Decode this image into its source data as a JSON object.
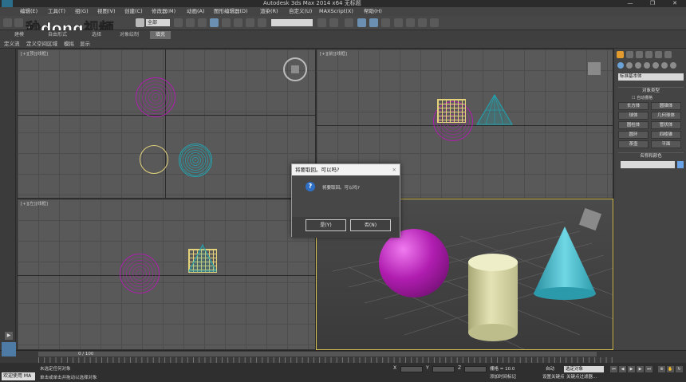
{
  "window": {
    "title": "Autodesk 3ds Max  2014 x64      无标题",
    "minimize": "—",
    "maximize": "❐",
    "close": "✕"
  },
  "menu": [
    "编辑(E)",
    "工具(T)",
    "组(G)",
    "视图(V)",
    "创建(C)",
    "修改器(M)",
    "动画(A)",
    "图形编辑器(D)",
    "渲染(R)",
    "自定义(U)",
    "MAXScript(X)",
    "帮助(H)"
  ],
  "toolbar": {
    "select_filter": "全部",
    "selection_set": ""
  },
  "ribbon": {
    "labels": [
      "建模",
      "自由形式",
      "选择",
      "对象绘制"
    ],
    "active": "填充"
  },
  "subtoolbar": [
    "定义流",
    "定义空间区域",
    "模拟",
    "显示"
  ],
  "viewports": {
    "top_label": "[+][顶][线框]",
    "front_label": "[+][前][线框]",
    "left_label": "[+][左][线框]"
  },
  "command_panel": {
    "dropdown": "标准基本体",
    "object_type_title": "对象类型",
    "autogrid": "自动栅格",
    "buttons": [
      "长方体",
      "圆锥体",
      "球体",
      "几何球体",
      "圆柱体",
      "管状体",
      "圆环",
      "四棱锥",
      "茶壶",
      "平面"
    ],
    "name_color_title": "名称和颜色"
  },
  "timeline": {
    "slider_label": "0 / 100"
  },
  "status": {
    "welcome": "欢迎使用 MA",
    "line1": "未选定任何对象",
    "line2": "单击或单击并拖动以选择对象",
    "x_label": "X",
    "y_label": "Y",
    "z_label": "Z",
    "grid": "栅格 = 10.0",
    "add_time_tag": "添加时间标记",
    "auto_key": "自动",
    "set_key": "设置关键点",
    "selected": "选定对象",
    "key_filters": "关键点过滤器..."
  },
  "watermark": "秒dong视频",
  "dialog": {
    "title": "将要取回。可以吗?",
    "close": "✕",
    "message": "将要取回。可以吗?",
    "yes": "是(Y)",
    "no": "否(N)"
  },
  "colors": {
    "sphere": "#b01db0",
    "cylinder": "#1fa6b3",
    "box": "#e3d27a",
    "persp_border": "#d6c152",
    "dialog_icon": "#2e6fc4"
  }
}
